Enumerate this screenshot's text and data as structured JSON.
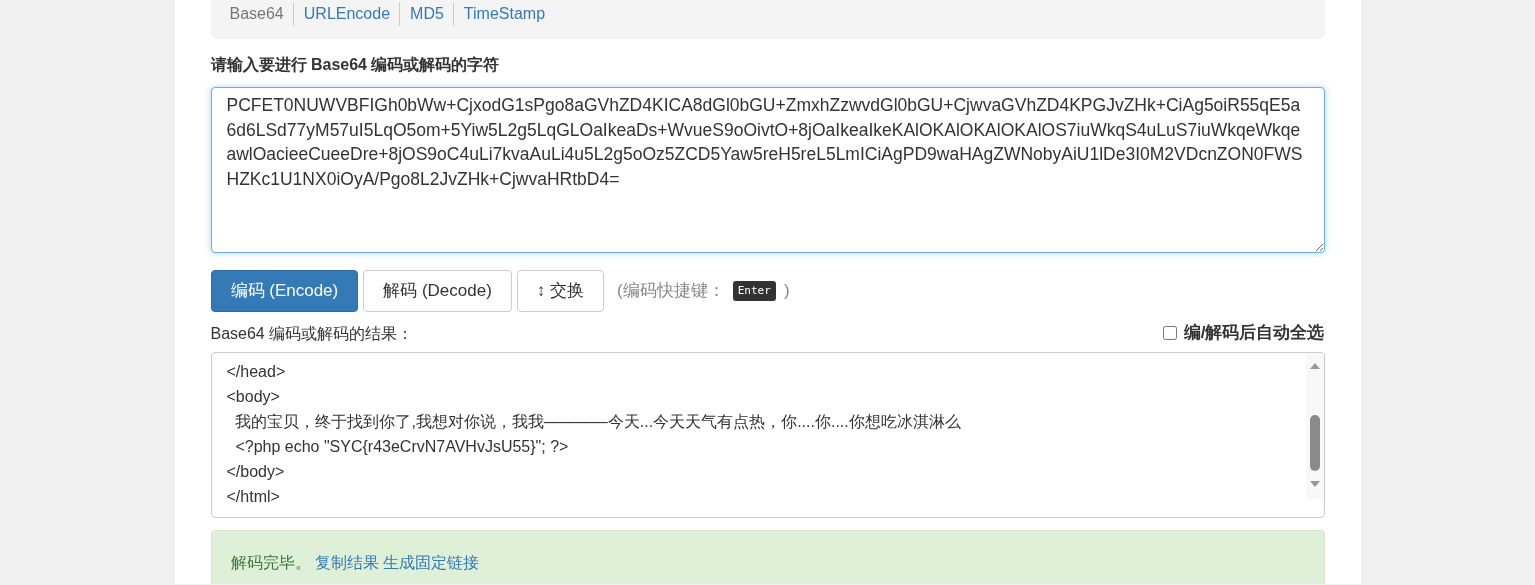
{
  "nav": [
    {
      "label": "Base64",
      "selected": true
    },
    {
      "label": "URLEncode",
      "selected": false
    },
    {
      "label": "MD5",
      "selected": false
    },
    {
      "label": "TimeStamp",
      "selected": false
    }
  ],
  "input_label": "请输入要进行 Base64 编码或解码的字符",
  "input_value": "PCFET0NUWVBFIGh0bWw+CjxodG1sPgo8aGVhZD4KICA8dGl0bGU+ZmxhZzwvdGl0bGU+CjwvaGVhZD4KPGJvZHk+CiAg5oiR55qE5a6d6LSd77yM57uI5LqO5om+5Yiw5L2g5LqGLOaIkeaDs+WvueS9oOivtO+8jOaIkeaIkeKAlOKAlOKAlOKAlOS7iuWkqS4uLuS7iuWkqeWkqeawlOacieeCueeDre+8jOS9oC4uLi7kvaAuLi4u5L2g5oOz5ZCD5Yaw5reH5reL5LmICiAgPD9waHAgZWNobyAiU1lDe3I0M2VDcnZON0FWSHZKc1U1NX0iOyA/Pgo8L2JvZHk+CjwvaHRtbD4=",
  "buttons": [
    {
      "label": "编码 (Encode)",
      "kind": "primary"
    },
    {
      "label": "解码 (Decode)",
      "kind": "default"
    },
    {
      "label": "↕ 交换",
      "kind": "default"
    }
  ],
  "hint": {
    "text": "(编码快捷键：",
    "key": "Enter",
    "close": ")"
  },
  "result_label": "Base64 编码或解码的结果：",
  "auto_select": {
    "label": "编/解码后自动全选",
    "checked": false
  },
  "output_lines": [
    "</head>",
    "<body>",
    "  我的宝贝，终于找到你了,我想对你说，我我————今天...今天天气有点热，你....你....你想吃冰淇淋么",
    "  <?php echo \"SYC{r43eCrvN7AVHvJsU55}\"; ?>",
    "</body>",
    "</html>"
  ],
  "alert": {
    "message": "解码完毕。",
    "links": [
      "复制结果",
      "生成固定链接"
    ]
  }
}
